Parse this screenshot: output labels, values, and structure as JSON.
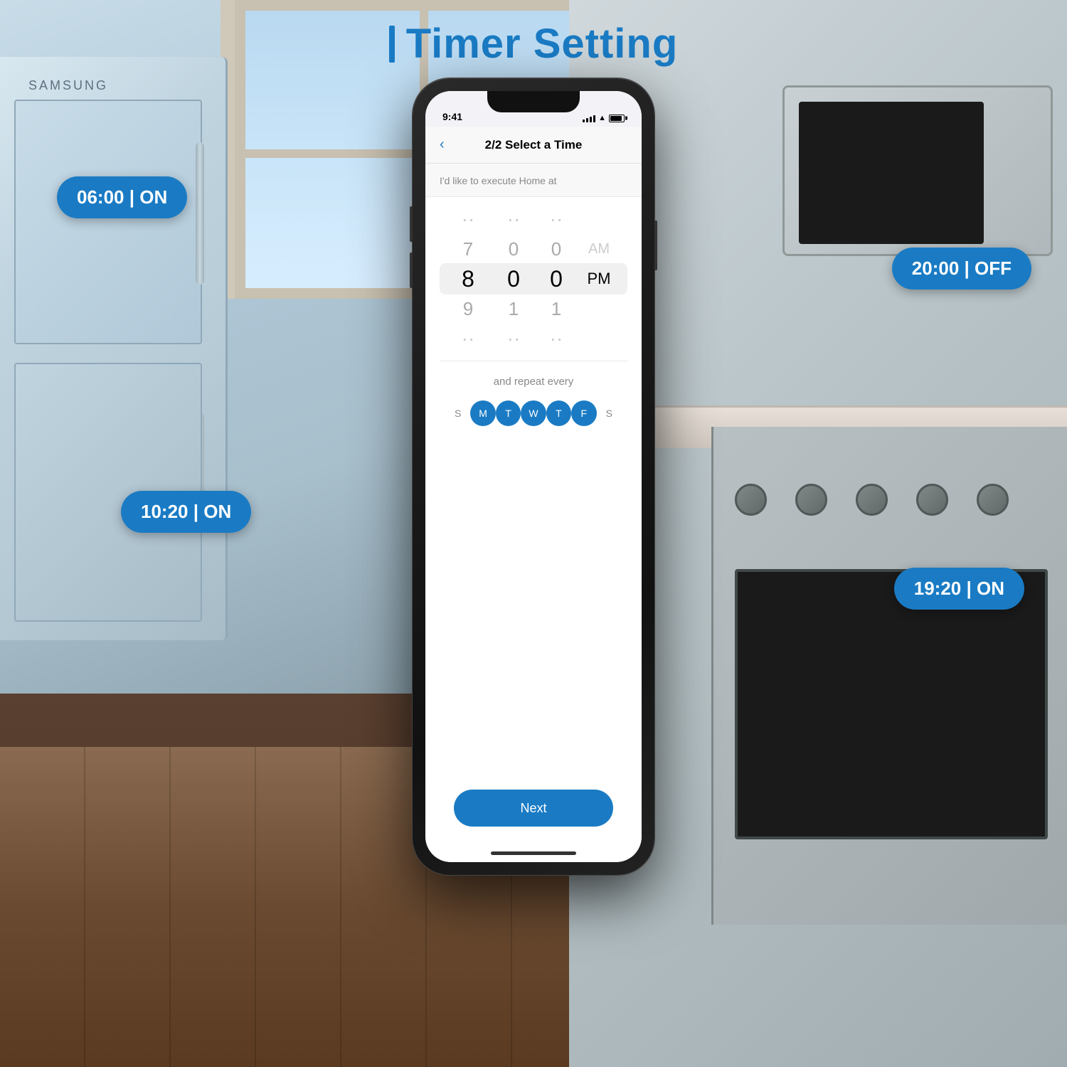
{
  "page": {
    "title": "Timer Setting",
    "title_bar_label": "|"
  },
  "badges": {
    "badge_on_06": "06:00 | ON",
    "badge_on_1020": "10:20 | ON",
    "badge_off_20": "20:00 | OFF",
    "badge_on_1920": "19:20 | ON"
  },
  "phone": {
    "status_bar": {
      "time": "9:41"
    },
    "nav": {
      "back_label": "‹",
      "title": "2/2 Select a Time"
    },
    "subtitle": "I'd like to execute Home at",
    "time_picker": {
      "hours": [
        "",
        "7",
        "8",
        "9",
        ""
      ],
      "minutes": [
        "",
        "0",
        "0",
        "1",
        ""
      ],
      "seconds": [
        "",
        "0",
        "0",
        "1",
        ""
      ],
      "ampm": [
        "AM",
        "PM",
        ""
      ],
      "hour_above": "..",
      "hour_selected": "8",
      "hour_below": "9",
      "min_above": "0",
      "min_selected": "0",
      "min_below": "1",
      "sec_above": "0",
      "sec_selected": "0",
      "sec_below": "1",
      "ampm_above": "AM",
      "ampm_selected": "PM"
    },
    "repeat_label": "and repeat every",
    "days": [
      {
        "label": "S",
        "active": false
      },
      {
        "label": "M",
        "active": true
      },
      {
        "label": "T",
        "active": true
      },
      {
        "label": "W",
        "active": true
      },
      {
        "label": "T",
        "active": true
      },
      {
        "label": "F",
        "active": true
      },
      {
        "label": "S",
        "active": false
      }
    ],
    "next_button": "Next"
  }
}
